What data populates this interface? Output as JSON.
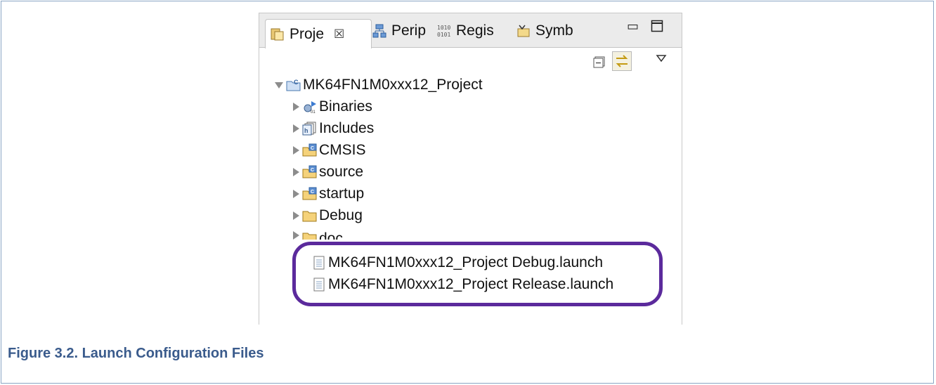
{
  "tabs": [
    {
      "label": "Proje",
      "icon": "project-explorer-icon",
      "active": true
    },
    {
      "label": "Perip",
      "icon": "peripherals-icon"
    },
    {
      "label": "Regis",
      "icon": "registers-icon"
    },
    {
      "label": "Symb",
      "icon": "symbols-icon"
    }
  ],
  "tab_close_glyph": "☒",
  "tree": {
    "project": "MK64FN1M0xxx12_Project",
    "items": [
      {
        "label": "Binaries",
        "icon": "binaries-icon"
      },
      {
        "label": "Includes",
        "icon": "includes-icon"
      },
      {
        "label": "CMSIS",
        "icon": "source-folder-icon"
      },
      {
        "label": "source",
        "icon": "source-folder-icon"
      },
      {
        "label": "startup",
        "icon": "source-folder-icon"
      },
      {
        "label": "Debug",
        "icon": "folder-icon"
      },
      {
        "label": "doc",
        "icon": "folder-icon"
      }
    ],
    "files": [
      {
        "label": "MK64FN1M0xxx12_Project Debug.launch",
        "icon": "launch-file-icon"
      },
      {
        "label": "MK64FN1M0xxx12_Project Release.launch",
        "icon": "launch-file-icon"
      }
    ]
  },
  "caption": "Figure 3.2. Launch Configuration Files",
  "colors": {
    "highlight": "#5b2a9c",
    "caption": "#3a5b8c"
  }
}
